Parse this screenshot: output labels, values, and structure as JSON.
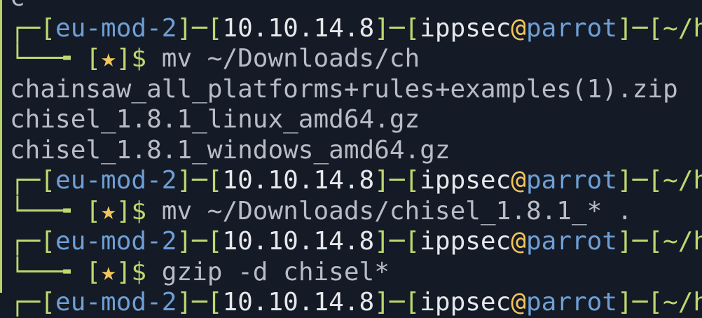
{
  "terminal": {
    "colors": {
      "green": "#bdd86f",
      "blue": "#6e9fd6",
      "white": "#e6e8ec",
      "star": "#f2c55c",
      "text": "#b7bcc6",
      "background": "#151b26"
    },
    "lines": [
      {
        "type": "output",
        "text": "c"
      },
      {
        "type": "prompt",
        "vpn": "eu-mod-2",
        "ip": "10.10.14.8",
        "user": "ippsec",
        "host": "parrot",
        "dir": "~/h"
      },
      {
        "type": "command",
        "star": "★",
        "cmd": "mv ~/Downloads/ch"
      },
      {
        "type": "output",
        "text": "chainsaw_all_platforms+rules+examples(1).zip"
      },
      {
        "type": "output",
        "text": "chisel_1.8.1_linux_amd64.gz"
      },
      {
        "type": "output",
        "text": "chisel_1.8.1_windows_amd64.gz"
      },
      {
        "type": "prompt",
        "vpn": "eu-mod-2",
        "ip": "10.10.14.8",
        "user": "ippsec",
        "host": "parrot",
        "dir": "~/h"
      },
      {
        "type": "command",
        "star": "★",
        "cmd": "mv ~/Downloads/chisel_1.8.1_* ."
      },
      {
        "type": "prompt",
        "vpn": "eu-mod-2",
        "ip": "10.10.14.8",
        "user": "ippsec",
        "host": "parrot",
        "dir": "~/h"
      },
      {
        "type": "command",
        "star": "★",
        "cmd": "gzip -d chisel*"
      },
      {
        "type": "prompt",
        "vpn": "eu-mod-2",
        "ip": "10.10.14.8",
        "user": "ippsec",
        "host": "parrot",
        "dir": "~/h"
      }
    ]
  }
}
